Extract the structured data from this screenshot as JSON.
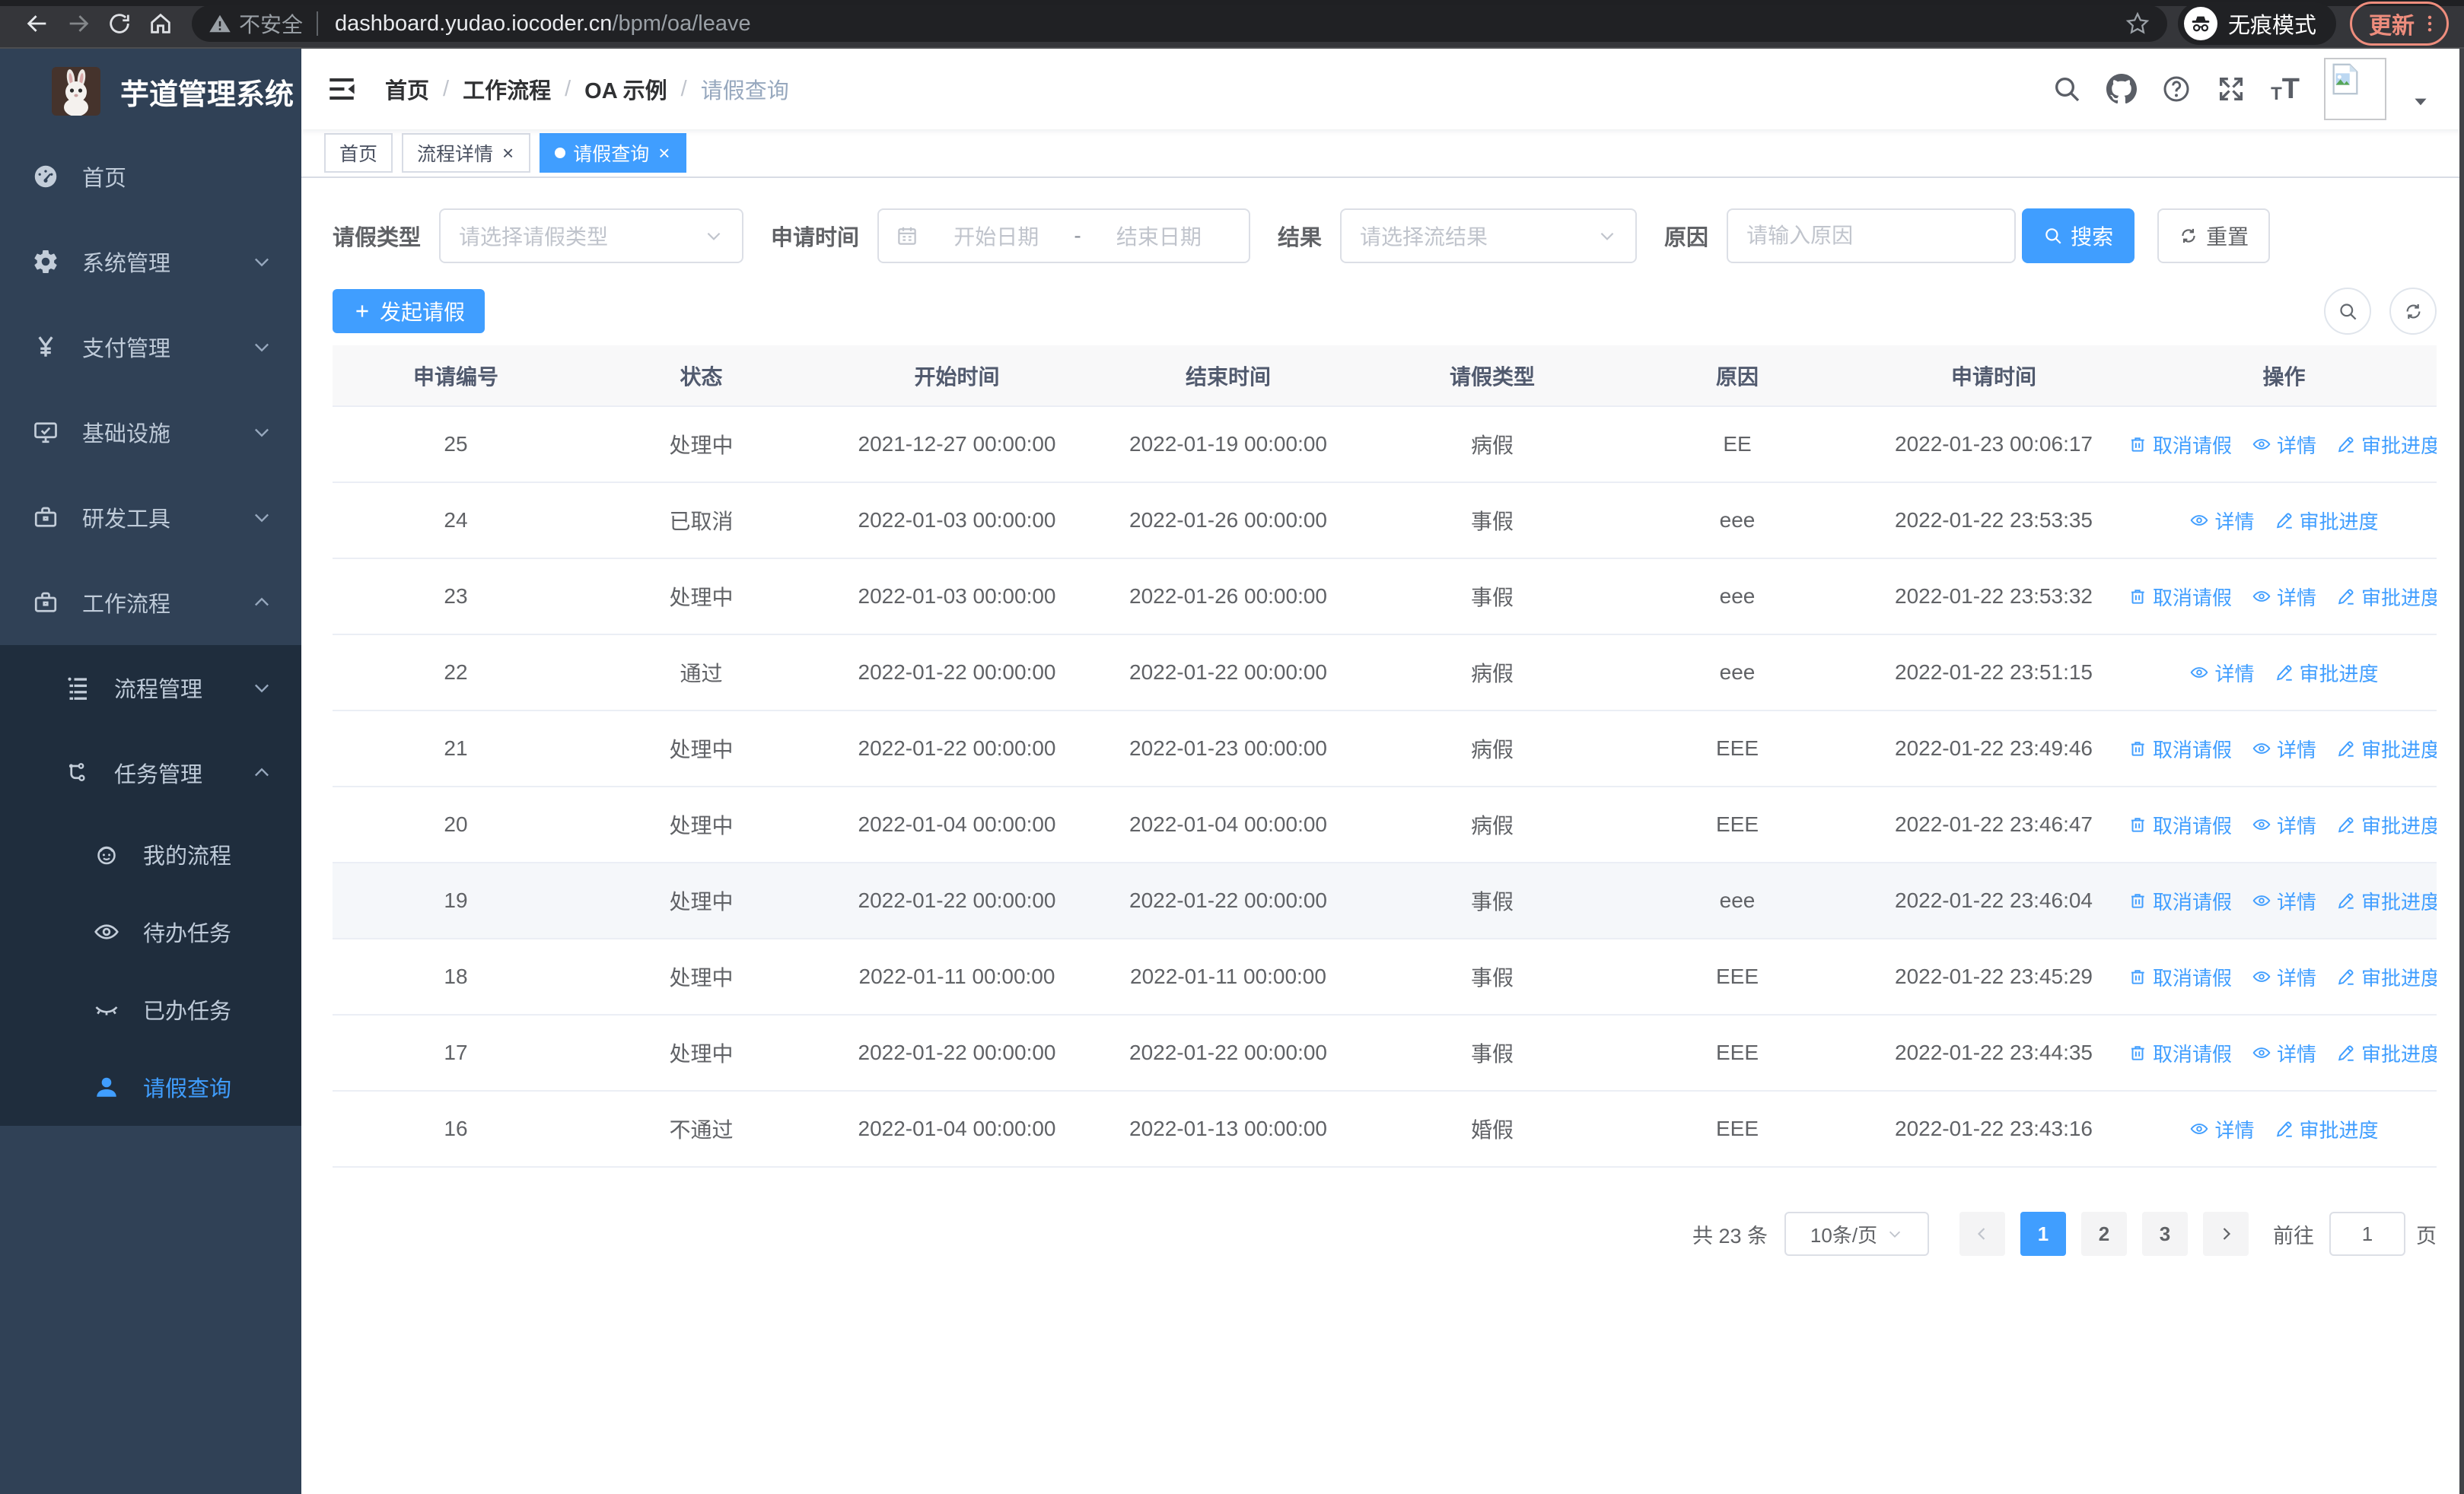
{
  "browser": {
    "security_label": "不安全",
    "url_host": "dashboard.yudao.iocoder.cn",
    "url_path": "/bpm/oa/leave",
    "incognito_label": "无痕模式",
    "update_label": "更新"
  },
  "icons": {
    "close": "×"
  },
  "sidebar": {
    "title": "芋道管理系统",
    "menu": [
      {
        "label": "首页"
      },
      {
        "label": "系统管理"
      },
      {
        "label": "支付管理"
      },
      {
        "label": "基础设施"
      },
      {
        "label": "研发工具"
      },
      {
        "label": "工作流程"
      },
      {
        "label": "流程管理"
      },
      {
        "label": "任务管理"
      },
      {
        "label": "我的流程"
      },
      {
        "label": "待办任务"
      },
      {
        "label": "已办任务"
      },
      {
        "label": "请假查询"
      }
    ]
  },
  "breadcrumb": [
    "首页",
    "工作流程",
    "OA 示例",
    "请假查询"
  ],
  "tabs": [
    {
      "label": "首页"
    },
    {
      "label": "流程详情"
    },
    {
      "label": "请假查询"
    }
  ],
  "filters": {
    "leave_type_label": "请假类型",
    "leave_type_placeholder": "请选择请假类型",
    "apply_time_label": "申请时间",
    "start_date_placeholder": "开始日期",
    "range_separator": "-",
    "end_date_placeholder": "结束日期",
    "result_label": "结果",
    "result_placeholder": "请选择流结果",
    "reason_label": "原因",
    "reason_placeholder": "请输入原因",
    "search_label": "搜索",
    "reset_label": "重置"
  },
  "toolbar": {
    "create_label": "发起请假"
  },
  "table": {
    "columns": [
      "申请编号",
      "状态",
      "开始时间",
      "结束时间",
      "请假类型",
      "原因",
      "申请时间",
      "操作"
    ],
    "action_defs": {
      "cancel": {
        "label": "取消请假",
        "icon": "i-trash",
        "icon_name": "trash-icon"
      },
      "detail": {
        "label": "详情",
        "icon": "i-eye",
        "icon_name": "eye-icon"
      },
      "progress": {
        "label": "审批进度",
        "icon": "i-pen",
        "icon_name": "pen-icon"
      }
    },
    "highlighted_row_id": "19",
    "rows": [
      {
        "id": "25",
        "status": "处理中",
        "start_time": "2021-12-27 00:00:00",
        "end_time": "2022-01-19 00:00:00",
        "leave_type": "病假",
        "reason": "EE",
        "apply_time": "2022-01-23 00:06:17",
        "actions": [
          "cancel",
          "detail",
          "progress"
        ]
      },
      {
        "id": "24",
        "status": "已取消",
        "start_time": "2022-01-03 00:00:00",
        "end_time": "2022-01-26 00:00:00",
        "leave_type": "事假",
        "reason": "eee",
        "apply_time": "2022-01-22 23:53:35",
        "actions": [
          "detail",
          "progress"
        ]
      },
      {
        "id": "23",
        "status": "处理中",
        "start_time": "2022-01-03 00:00:00",
        "end_time": "2022-01-26 00:00:00",
        "leave_type": "事假",
        "reason": "eee",
        "apply_time": "2022-01-22 23:53:32",
        "actions": [
          "cancel",
          "detail",
          "progress"
        ]
      },
      {
        "id": "22",
        "status": "通过",
        "start_time": "2022-01-22 00:00:00",
        "end_time": "2022-01-22 00:00:00",
        "leave_type": "病假",
        "reason": "eee",
        "apply_time": "2022-01-22 23:51:15",
        "actions": [
          "detail",
          "progress"
        ]
      },
      {
        "id": "21",
        "status": "处理中",
        "start_time": "2022-01-22 00:00:00",
        "end_time": "2022-01-23 00:00:00",
        "leave_type": "病假",
        "reason": "EEE",
        "apply_time": "2022-01-22 23:49:46",
        "actions": [
          "cancel",
          "detail",
          "progress"
        ]
      },
      {
        "id": "20",
        "status": "处理中",
        "start_time": "2022-01-04 00:00:00",
        "end_time": "2022-01-04 00:00:00",
        "leave_type": "病假",
        "reason": "EEE",
        "apply_time": "2022-01-22 23:46:47",
        "actions": [
          "cancel",
          "detail",
          "progress"
        ]
      },
      {
        "id": "19",
        "status": "处理中",
        "start_time": "2022-01-22 00:00:00",
        "end_time": "2022-01-22 00:00:00",
        "leave_type": "事假",
        "reason": "eee",
        "apply_time": "2022-01-22 23:46:04",
        "actions": [
          "cancel",
          "detail",
          "progress"
        ]
      },
      {
        "id": "18",
        "status": "处理中",
        "start_time": "2022-01-11 00:00:00",
        "end_time": "2022-01-11 00:00:00",
        "leave_type": "事假",
        "reason": "EEE",
        "apply_time": "2022-01-22 23:45:29",
        "actions": [
          "cancel",
          "detail",
          "progress"
        ]
      },
      {
        "id": "17",
        "status": "处理中",
        "start_time": "2022-01-22 00:00:00",
        "end_time": "2022-01-22 00:00:00",
        "leave_type": "事假",
        "reason": "EEE",
        "apply_time": "2022-01-22 23:44:35",
        "actions": [
          "cancel",
          "detail",
          "progress"
        ]
      },
      {
        "id": "16",
        "status": "不通过",
        "start_time": "2022-01-04 00:00:00",
        "end_time": "2022-01-13 00:00:00",
        "leave_type": "婚假",
        "reason": "EEE",
        "apply_time": "2022-01-22 23:43:16",
        "actions": [
          "detail",
          "progress"
        ]
      }
    ]
  },
  "pagination": {
    "total_label": "共 23 条",
    "page_size_label": "10条/页",
    "pages": [
      "1",
      "2",
      "3"
    ],
    "active_page": "1",
    "goto_label": "前往",
    "goto_value": "1",
    "unit_label": "页"
  },
  "colors": {
    "primary": "#409eff",
    "sidebar_bg": "#304156",
    "submenu_bg": "#1f2d3d",
    "update_accent": "#ee8d7d"
  }
}
